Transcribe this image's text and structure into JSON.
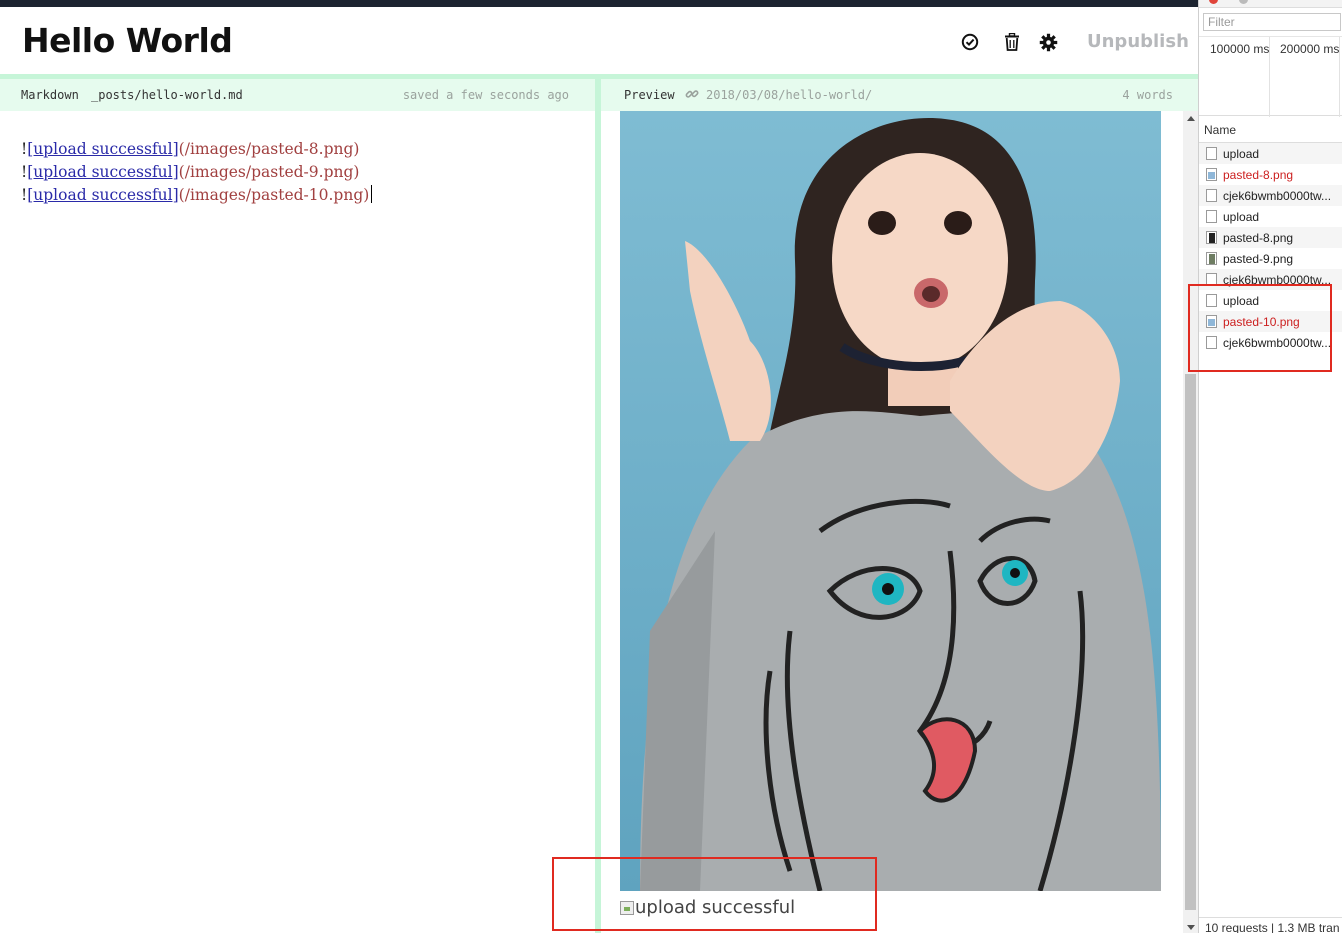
{
  "header": {
    "title": "Hello World",
    "icons": [
      "check-circle-icon",
      "trash-icon",
      "gear-icon"
    ],
    "unpublish_label": "Unpublish"
  },
  "editor_bar": {
    "mode": "Markdown",
    "path": "_posts/hello-world.md",
    "saved": "saved a few seconds ago"
  },
  "preview_bar": {
    "label": "Preview",
    "url": "2018/03/08/hello-world/",
    "words": "4 words"
  },
  "editor": {
    "lines": [
      {
        "bang": "!",
        "link": "[upload successful]",
        "url": "(/images/pasted-8.png)"
      },
      {
        "bang": "!",
        "link": "[upload successful]",
        "url": "(/images/pasted-9.png)"
      },
      {
        "bang": "!",
        "link": "[upload successful]",
        "url": "(/images/pasted-10.png)"
      }
    ]
  },
  "preview": {
    "broken_alt": "upload successful"
  },
  "devtools": {
    "filter_placeholder": "Filter",
    "ticks": [
      "100000 ms",
      "200000 ms"
    ],
    "name_header": "Name",
    "requests": [
      {
        "name": "upload",
        "icon": "blank",
        "error": false
      },
      {
        "name": "pasted-8.png",
        "icon": "img",
        "error": true
      },
      {
        "name": "cjek6bwmb0000tw...",
        "icon": "blank",
        "error": false
      },
      {
        "name": "upload",
        "icon": "blank",
        "error": false
      },
      {
        "name": "pasted-8.png",
        "icon": "dark",
        "error": false
      },
      {
        "name": "pasted-9.png",
        "icon": "pic",
        "error": false
      },
      {
        "name": "cjek6bwmb0000tw...",
        "icon": "blank",
        "error": false
      },
      {
        "name": "upload",
        "icon": "blank",
        "error": false
      },
      {
        "name": "pasted-10.png",
        "icon": "img",
        "error": true
      },
      {
        "name": "cjek6bwmb0000tw...",
        "icon": "blank",
        "error": false
      }
    ],
    "status": "10 requests | 1.3 MB tran"
  },
  "colors": {
    "accent_green": "#c6f5d8",
    "annotation_red": "#e02a20",
    "error_red": "#cc1f1f"
  }
}
